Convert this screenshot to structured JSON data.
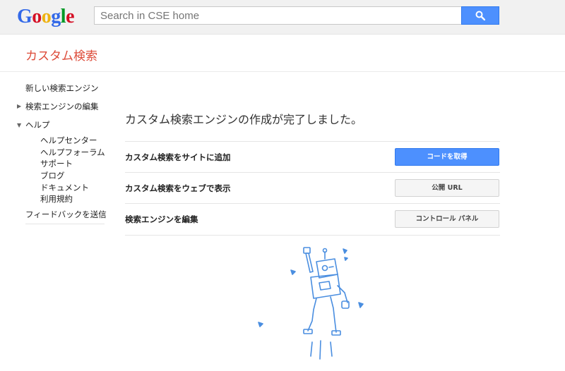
{
  "logo": {
    "letters": [
      "G",
      "o",
      "o",
      "g",
      "l",
      "e"
    ],
    "colors": [
      "#3369e8",
      "#d50f25",
      "#eeb211",
      "#3369e8",
      "#009925",
      "#d50f25"
    ]
  },
  "search": {
    "placeholder": "Search in CSE home",
    "button_icon": "search-icon"
  },
  "header": {
    "title": "カスタム検索"
  },
  "sidebar": {
    "new_engine": "新しい検索エンジン",
    "edit_engine": "検索エンジンの編集",
    "help": "ヘルプ",
    "help_items": [
      "ヘルプセンター",
      "ヘルプフォーラム",
      "サポート",
      "ブログ",
      "ドキュメント",
      "利用規約"
    ],
    "feedback": "フィードバックを送信"
  },
  "main": {
    "title": "カスタム検索エンジンの作成が完了しました。",
    "rows": [
      {
        "label": "カスタム検索をサイトに追加",
        "button": "コードを取得"
      },
      {
        "label": "カスタム検索をウェブで表示",
        "button": "公開 URL"
      },
      {
        "label": "検索エンジンを編集",
        "button": "コントロール パネル"
      }
    ]
  },
  "colors": {
    "accent": "#4d90fe",
    "title_red": "#dd4b39",
    "robot": "#4a8ee0"
  }
}
